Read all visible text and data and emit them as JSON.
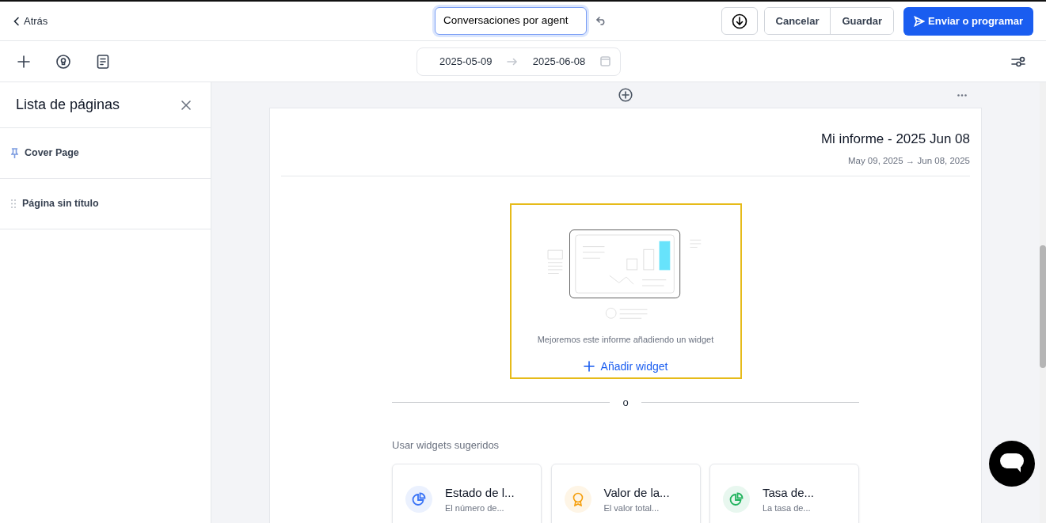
{
  "header": {
    "back_label": "Atrás",
    "title_value": "Conversaciones por agent",
    "buttons": [
      {
        "label": "Cancelar",
        "kind": "secondary"
      },
      {
        "label": "Guardar",
        "kind": "secondary"
      },
      {
        "label": "Enviar o programar",
        "kind": "primary"
      }
    ]
  },
  "date_range": {
    "start": "2025-05-09",
    "end": "2025-06-08"
  },
  "sidebar": {
    "title": "Lista de páginas",
    "items": [
      {
        "label": "Cover Page",
        "kind": "pinned"
      },
      {
        "label": "Página sin título",
        "kind": "draggable"
      }
    ]
  },
  "report": {
    "title": "Mi informe - 2025 Jun 08",
    "subtitle": "May 09, 2025 → Jun 08, 2025",
    "empty_text": "Mejoremos este informe añadiendo un widget",
    "add_widget": "Añadir widget",
    "separator": "o",
    "suggested_title": "Usar widgets sugeridos",
    "suggested": [
      {
        "title": "Estado de l...",
        "description": "El número de...",
        "kind": "pie",
        "color": "#3b74f6"
      },
      {
        "title": "Valor de la...",
        "description": "El valor total...",
        "kind": "award",
        "color": "#f59e0b"
      },
      {
        "title": "Tasa de...",
        "description": "La tasa de...",
        "kind": "pie",
        "color": "#22b35e"
      }
    ]
  }
}
